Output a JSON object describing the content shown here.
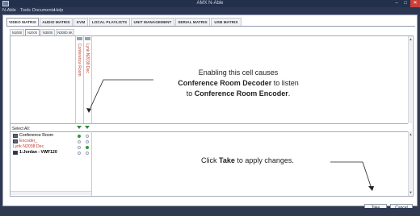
{
  "window": {
    "title": "AMX N-Able",
    "controls": {
      "minimize": "–",
      "maximize": "□",
      "close": "✕"
    },
    "app_icon": "amx-app-icon"
  },
  "menu": [
    "N-Able",
    "Tools",
    "Documents",
    "Help"
  ],
  "tabs": [
    {
      "label": "VIDEO MATRIX",
      "active": true
    },
    {
      "label": "AUDIO MATRIX",
      "active": false
    },
    {
      "label": "KVM",
      "active": false
    },
    {
      "label": "LOCAL PLAYLISTS",
      "active": false
    },
    {
      "label": "UNIT MANAGEMENT",
      "active": false
    },
    {
      "label": "SERIAL MATRIX",
      "active": false
    },
    {
      "label": "USB MATRIX",
      "active": false
    }
  ],
  "subtabs": [
    {
      "label": "N1000",
      "active": false
    },
    {
      "label": "N2000",
      "active": true
    },
    {
      "label": "N3000",
      "active": false
    },
    {
      "label": "N3000 4K",
      "active": false
    }
  ],
  "matrix": {
    "columns": [
      {
        "label": "Conference Room"
      },
      {
        "label": "Lynk N2038 Dec"
      }
    ],
    "select_all_label": "Select All:",
    "rows": [
      {
        "label": "Conference Room",
        "color": "#222222",
        "icon": "device-icon",
        "cells": [
          true,
          false
        ]
      },
      {
        "label": "Encoder_",
        "color": "#c0392b",
        "icon": "device-icon",
        "cells": [
          false,
          false
        ]
      },
      {
        "label": "Lynk N2038 Dec",
        "color": "#c0392b",
        "icon": "",
        "cells": [
          false,
          true
        ]
      },
      {
        "label": "1:Jordan - VWF120",
        "color": "#222222",
        "icon": "grid-icon",
        "cells": [
          false,
          false
        ]
      }
    ]
  },
  "annotations": {
    "callout_line1": "Enabling this cell causes",
    "callout_bold1": "Conference Room Decoder",
    "callout_line2_rest": " to listen",
    "callout_line3_pre": "to ",
    "callout_bold2": "Conference Room Encoder",
    "callout_line3_post": ".",
    "apply_pre": "Click ",
    "apply_bold": "Take",
    "apply_post": " to apply changes."
  },
  "buttons": {
    "take": "Take",
    "cancel": "Cancel"
  },
  "colors": {
    "active_dot": "#2c9a3c",
    "inactive_dot": "#ffffff",
    "decoder_label": "#c0392b",
    "title_bar": "#23304c",
    "window_bg": "#2f3a52"
  }
}
